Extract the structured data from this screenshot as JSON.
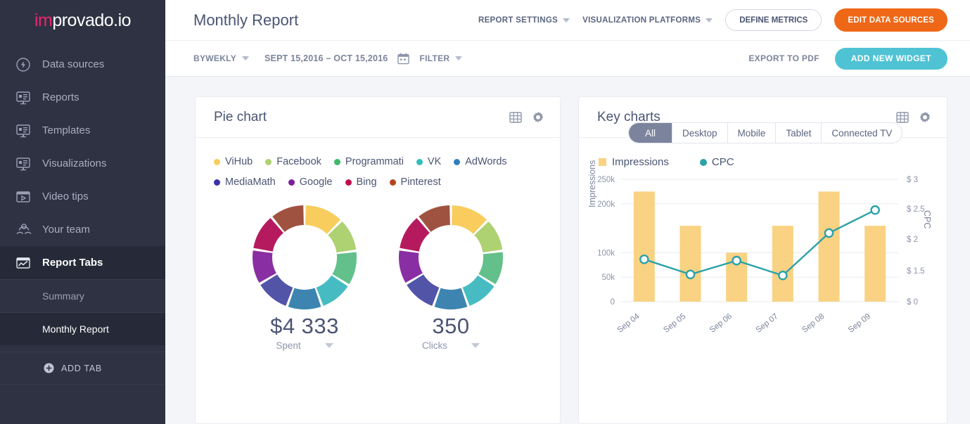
{
  "brand": {
    "logo_prefix": "im",
    "logo_suffix": "provado.io",
    "pink": "#e8266e"
  },
  "sidebar": {
    "items": [
      {
        "label": "Data sources",
        "icon": "bolt-circle-icon"
      },
      {
        "label": "Reports",
        "icon": "monitor-report-icon"
      },
      {
        "label": "Templates",
        "icon": "monitor-report-icon"
      },
      {
        "label": "Visualizations",
        "icon": "monitor-report-icon"
      },
      {
        "label": "Video tips",
        "icon": "video-window-icon"
      },
      {
        "label": "Your team",
        "icon": "team-icon"
      },
      {
        "label": "Report Tabs",
        "icon": "chart-window-icon"
      }
    ],
    "sub_items": [
      {
        "label": "Summary"
      },
      {
        "label": "Monthly Report"
      }
    ],
    "add_tab_label": "ADD TAB"
  },
  "header": {
    "title": "Monthly Report",
    "report_settings": "REPORT SETTINGS",
    "visualization_platforms": "VISUALIZATION PLATFORMS",
    "define_metrics": "DEFINE METRICS",
    "edit_data_sources": "EDIT DATA SOURCES",
    "orange": "#ef6817"
  },
  "toolbar": {
    "period": "BYWEKLY",
    "date_range": "SEPT 15,2016 – OCT 15,2016",
    "filter": "FILTER",
    "export_pdf": "EXPORT TO PDF",
    "add_widget": "ADD NEW WIDGET",
    "teal": "#4fc3d4"
  },
  "pie_card": {
    "title": "Pie chart",
    "icons": [
      "table-grid-icon",
      "gear-icon"
    ],
    "legend_rows": [
      [
        {
          "label": "ViHub",
          "color": "#f5c килт"
        }
      ]
    ]
  },
  "key_card": {
    "title": "Key charts",
    "icons": [
      "table-grid-icon",
      "gear-icon"
    ],
    "tabs": [
      {
        "label": "All",
        "active": true
      },
      {
        "label": "Desktop",
        "active": false
      },
      {
        "label": "Mobile",
        "active": false
      },
      {
        "label": "Tablet",
        "active": false
      },
      {
        "label": "Connected TV",
        "active": false
      }
    ]
  },
  "chart_data": [
    {
      "type": "pie",
      "title": "Pie chart",
      "legend_position": "top",
      "charts": [
        {
          "center_value": "$4 333",
          "center_label": "Spent",
          "labels": [
            "ViHub",
            "Facebook",
            "Programmati",
            "VK",
            "AdWords",
            "MediaMath",
            "Google",
            "Bing",
            "Pinterest"
          ],
          "values": [
            12.5,
            10.5,
            11,
            10.5,
            11,
            11,
            11,
            11.5,
            11
          ],
          "colors": [
            "#f8cd5e",
            "#aed171",
            "#63c08b",
            "#46bcc2",
            "#3d85b0",
            "#5254a8",
            "#8a2fa3",
            "#b51a5e",
            "#a05240"
          ]
        },
        {
          "center_value": "350",
          "center_label": "Clicks",
          "labels": [
            "ViHub",
            "Facebook",
            "Programmati",
            "VK",
            "AdWords",
            "MediaMath",
            "Google",
            "Bing",
            "Pinterest"
          ],
          "values": [
            12.5,
            10.5,
            11,
            10.5,
            11,
            11,
            11,
            11.5,
            11
          ],
          "colors": [
            "#f8cd5e",
            "#aed171",
            "#63c08b",
            "#46bcc2",
            "#3d85b0",
            "#5254a8",
            "#8a2fa3",
            "#b51a5e",
            "#a05240"
          ]
        }
      ],
      "legend": [
        {
          "label": "ViHub",
          "color": "#f8cd5e"
        },
        {
          "label": "Facebook",
          "color": "#aed171"
        },
        {
          "label": "Programmati",
          "color": "#3fb96a"
        },
        {
          "label": "VK",
          "color": "#2fbdbd"
        },
        {
          "label": "AdWords",
          "color": "#2e7fc1"
        },
        {
          "label": "MediaMath",
          "color": "#3c31a8"
        },
        {
          "label": "Google",
          "color": "#7d1d9e"
        },
        {
          "label": "Bing",
          "color": "#bf0f4a"
        },
        {
          "label": "Pinterest",
          "color": "#b4451f"
        }
      ]
    },
    {
      "type": "bar",
      "title": "Key charts",
      "categories": [
        "Sep 04",
        "Sep 05",
        "Sep 06",
        "Sep 07",
        "Sep 08",
        "Sep 09"
      ],
      "series": [
        {
          "name": "Impressions",
          "type": "bar",
          "axis": "left",
          "color": "#f9d283",
          "values": [
            225000,
            155000,
            100000,
            155000,
            225000,
            155000
          ]
        },
        {
          "name": "CPC",
          "type": "line",
          "axis": "right",
          "color": "#2ba2a8",
          "values": [
            1.68,
            1.32,
            1.66,
            1.27,
            2.1,
            2.48
          ]
        }
      ],
      "ylabel": "Impressions",
      "y2label": "CPC",
      "yticks": [
        "0",
        "50k",
        "100k",
        "200k",
        "250k"
      ],
      "ytick_values": [
        0,
        50000,
        100000,
        200000,
        250000
      ],
      "ylim": [
        0,
        250000
      ],
      "y2ticks": [
        "$ 0",
        "$ 1.5",
        "$ 2",
        "$ 2.5",
        "$ 3"
      ],
      "y2tick_values": [
        0,
        1.5,
        2,
        2.5,
        3
      ],
      "y2lim": [
        0,
        3
      ],
      "grid": true,
      "legend_position": "top-left"
    }
  ]
}
